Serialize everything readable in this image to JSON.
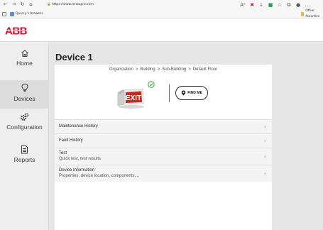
{
  "browser": {
    "url": "https://www.lenoxpro.com",
    "bookmarks": [
      {
        "label": "Querry's browser"
      },
      {
        "label": "Other favorites"
      }
    ]
  },
  "brand": {
    "logo_text": "ABB",
    "color": "#e4002b"
  },
  "sidenav": {
    "items": [
      {
        "label": "Home",
        "icon": "home-icon"
      },
      {
        "label": "Devices",
        "icon": "lightbulb-icon",
        "active": true
      },
      {
        "label": "Configuration",
        "icon": "gears-icon"
      },
      {
        "label": "Reports",
        "icon": "document-icon"
      }
    ]
  },
  "page": {
    "title": "Device 1",
    "breadcrumb": [
      "Organization",
      "Building",
      "Sub-Building",
      "Default Floor"
    ],
    "breadcrumb_separator": ">",
    "device_status": "ok",
    "exit_sign_text": "EXIT",
    "find_me_label": "FIND ME",
    "rows": [
      {
        "title": "Maintenance History",
        "subtitle": ""
      },
      {
        "title": "Fault History",
        "subtitle": ""
      },
      {
        "title": "Test",
        "subtitle": "Quick test, test results"
      },
      {
        "title": "Device Information",
        "subtitle": "Properties, device location, components,..."
      }
    ]
  }
}
